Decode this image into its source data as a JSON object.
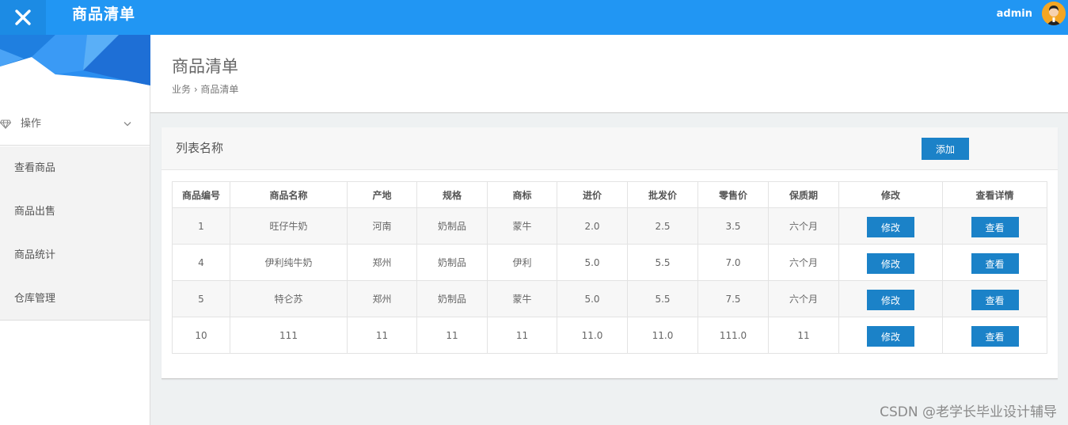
{
  "header": {
    "app_title": "商品清单",
    "user_name": "admin"
  },
  "icons": {
    "close": "close-icon",
    "avatar": "user-avatar",
    "menu": "diamond-icon",
    "chevron": "chevron-down-icon"
  },
  "colors": {
    "topbar": "#2196f3",
    "button": "#1b82c8"
  },
  "sidebar": {
    "group_label": "操作",
    "items": [
      {
        "label": "查看商品"
      },
      {
        "label": "商品出售"
      },
      {
        "label": "商品统计"
      },
      {
        "label": "仓库管理"
      }
    ]
  },
  "page": {
    "title": "商品清单",
    "breadcrumb": "业务 › 商品清单"
  },
  "panel": {
    "title": "列表名称",
    "add_label": "添加"
  },
  "table": {
    "headers": [
      "商品编号",
      "商品名称",
      "产地",
      "规格",
      "商标",
      "进价",
      "批发价",
      "零售价",
      "保质期",
      "修改",
      "查看详情"
    ],
    "rows": [
      {
        "id": "1",
        "name": "旺仔牛奶",
        "origin": "河南",
        "spec": "奶制品",
        "brand": "蒙牛",
        "cost": "2.0",
        "wholesale": "2.5",
        "retail": "3.5",
        "shelf": "六个月",
        "edit": "修改",
        "view": "查看"
      },
      {
        "id": "4",
        "name": "伊利纯牛奶",
        "origin": "郑州",
        "spec": "奶制品",
        "brand": "伊利",
        "cost": "5.0",
        "wholesale": "5.5",
        "retail": "7.0",
        "shelf": "六个月",
        "edit": "修改",
        "view": "查看"
      },
      {
        "id": "5",
        "name": "特仑苏",
        "origin": "郑州",
        "spec": "奶制品",
        "brand": "蒙牛",
        "cost": "5.0",
        "wholesale": "5.5",
        "retail": "7.5",
        "shelf": "六个月",
        "edit": "修改",
        "view": "查看"
      },
      {
        "id": "10",
        "name": "111",
        "origin": "11",
        "spec": "11",
        "brand": "11",
        "cost": "11.0",
        "wholesale": "11.0",
        "retail": "111.0",
        "shelf": "11",
        "edit": "修改",
        "view": "查看"
      }
    ]
  },
  "watermark": "CSDN @老学长毕业设计辅导"
}
